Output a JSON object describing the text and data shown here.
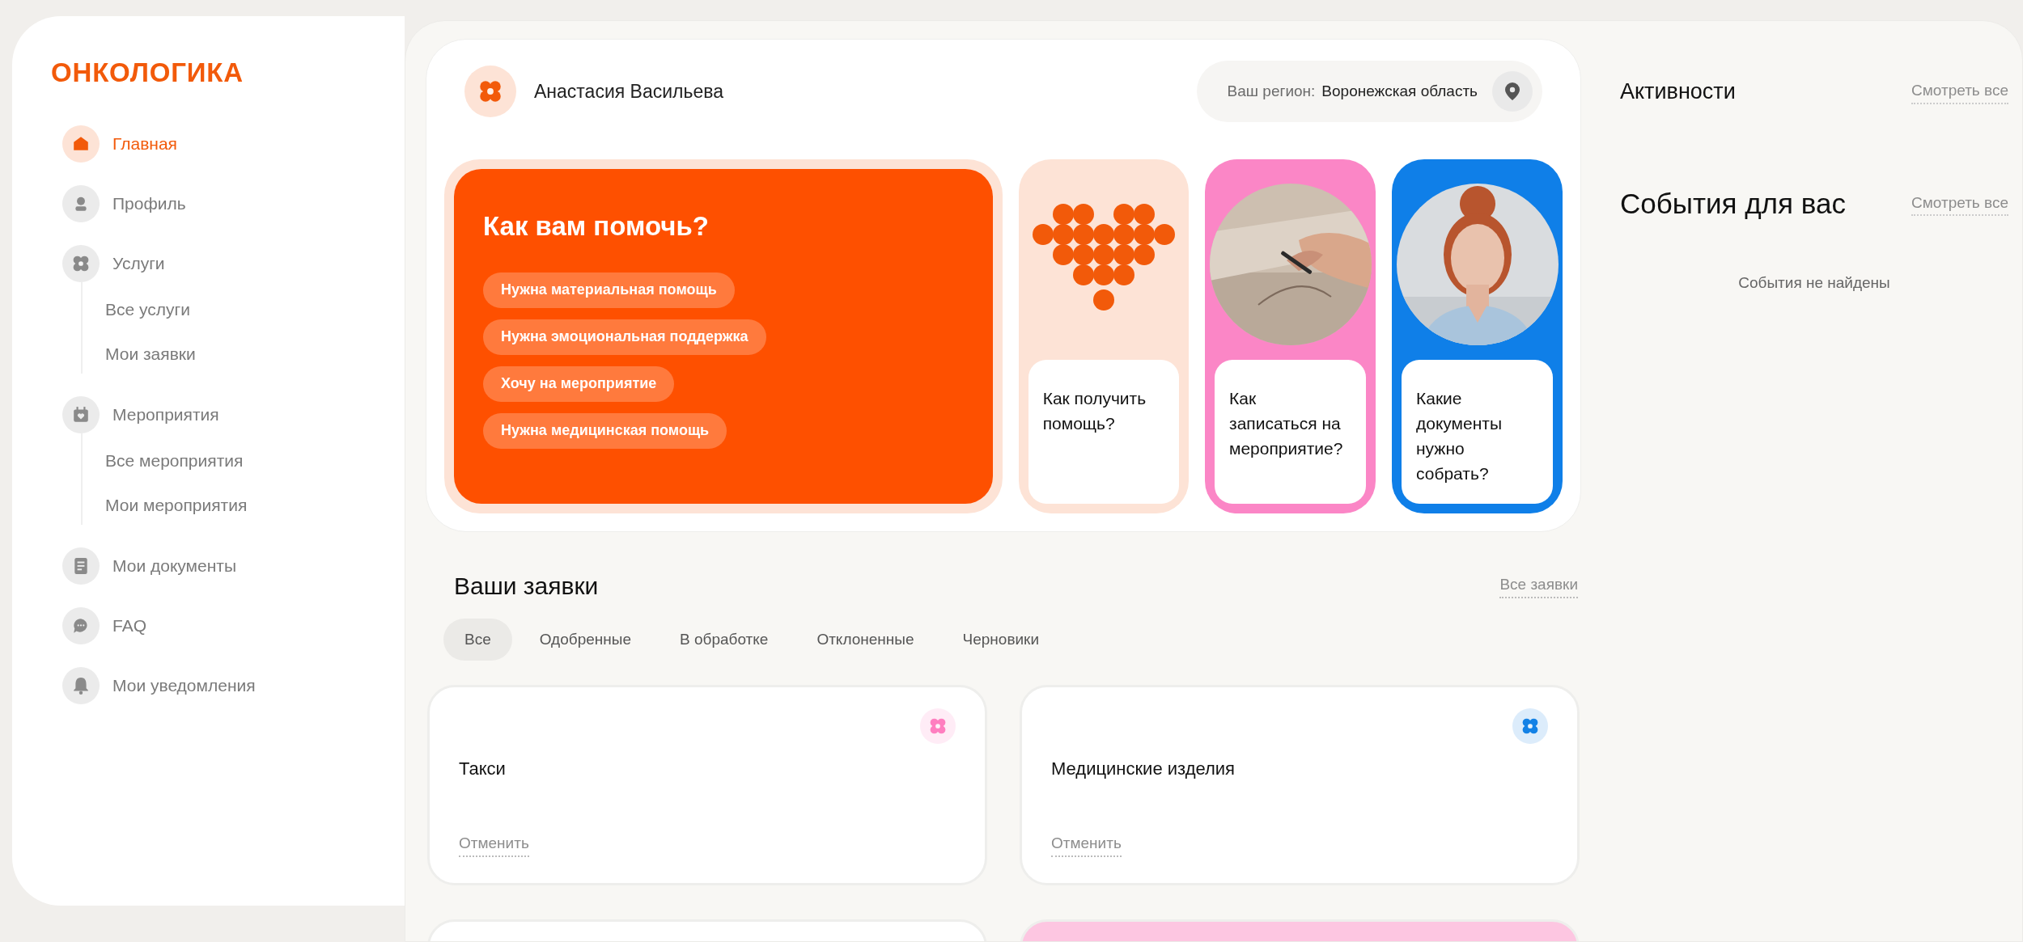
{
  "logo": "ОНКОЛОГИКА",
  "sidebar": {
    "items": [
      {
        "label": "Главная",
        "selected": true
      },
      {
        "label": "Профиль",
        "selected": false
      },
      {
        "label": "Услуги",
        "selected": false,
        "children": [
          {
            "label": "Все услуги",
            "selected": false
          },
          {
            "label": "Мои заявки",
            "selected": false
          }
        ]
      },
      {
        "label": "Мероприятия",
        "selected": false,
        "children": [
          {
            "label": "Все мероприятия",
            "selected": false
          },
          {
            "label": "Мои мероприятия",
            "selected": false
          }
        ]
      },
      {
        "label": "Мои документы",
        "selected": false
      },
      {
        "label": "FAQ",
        "selected": false
      },
      {
        "label": "Мои уведомления",
        "selected": false
      }
    ]
  },
  "header": {
    "user_name": "Анастасия Васильева",
    "region_label": "Ваш регион:",
    "region_value": "Воронежская область"
  },
  "help_card": {
    "title": "Как вам помочь?",
    "chips": [
      "Нужна материальная помощь",
      "Нужна эмоциональная поддержка",
      "Хочу на мероприятие",
      "Нужна медицинская помощь"
    ]
  },
  "faq_cards": [
    {
      "kind": "heart",
      "color": "#fde3d6",
      "text": "Как получить помощь?"
    },
    {
      "kind": "picture",
      "color": "#fb86c6",
      "text": "Как записаться на мероприятие?"
    },
    {
      "kind": "picture",
      "color": "#0f7fe8",
      "text": "Какие документы нужно собрать?"
    }
  ],
  "requests": {
    "title": "Ваши заявки",
    "all_link": "Все заявки",
    "tabs": [
      {
        "label": "Все",
        "selected": true
      },
      {
        "label": "Одобренные",
        "selected": false
      },
      {
        "label": "В обработке",
        "selected": false
      },
      {
        "label": "Отклоненные",
        "selected": false
      },
      {
        "label": "Черновики",
        "selected": false
      }
    ],
    "cards": [
      {
        "title": "Такси",
        "cancel": "Отменить",
        "badge": {
          "color": "#ff7fc0"
        },
        "color": "#ffffff"
      },
      {
        "title": "Медицинские изделия",
        "cancel": "Отменить",
        "badge": {
          "color": "#1482e6"
        },
        "color": "#ffffff"
      },
      {
        "color": "#ffffff"
      },
      {
        "color": "#fdc6e1"
      }
    ]
  },
  "activities": {
    "title": "Активности",
    "link": "Смотреть все"
  },
  "events": {
    "title": "События для вас",
    "link": "Смотреть все",
    "empty": "События не найдены"
  }
}
